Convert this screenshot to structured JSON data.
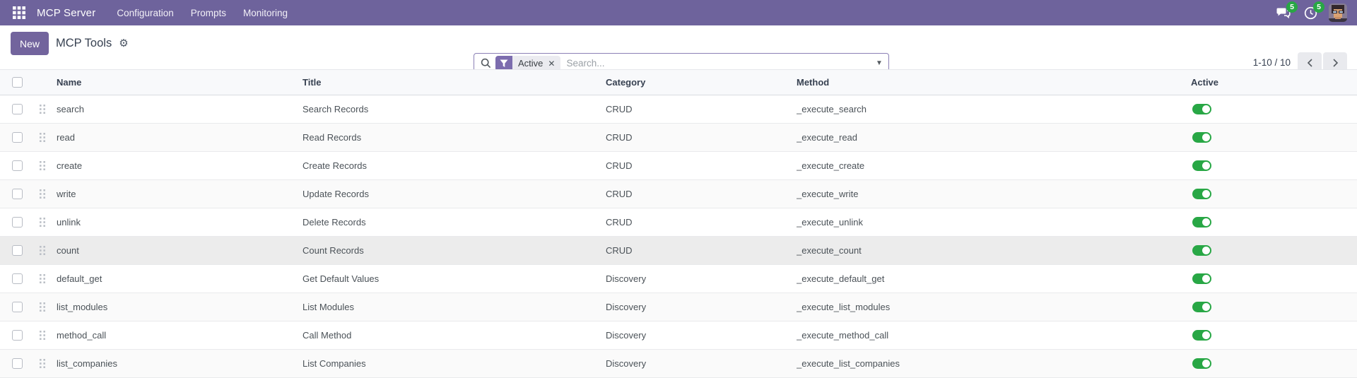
{
  "navbar": {
    "app_name": "MCP Server",
    "menus": [
      {
        "label": "Configuration"
      },
      {
        "label": "Prompts"
      },
      {
        "label": "Monitoring"
      }
    ],
    "messages_badge": "5",
    "activities_badge": "5"
  },
  "control_panel": {
    "new_button_label": "New",
    "breadcrumb_title": "MCP Tools",
    "search": {
      "filter_label": "Active",
      "placeholder": "Search...",
      "value": ""
    },
    "pager": {
      "range": "1-10 / 10",
      "prev": "‹",
      "next": "›"
    }
  },
  "table": {
    "columns": [
      "Name",
      "Title",
      "Category",
      "Method",
      "Active"
    ],
    "rows": [
      {
        "name": "search",
        "title": "Search Records",
        "category": "CRUD",
        "method": "_execute_search",
        "active": true
      },
      {
        "name": "read",
        "title": "Read Records",
        "category": "CRUD",
        "method": "_execute_read",
        "active": true
      },
      {
        "name": "create",
        "title": "Create Records",
        "category": "CRUD",
        "method": "_execute_create",
        "active": true
      },
      {
        "name": "write",
        "title": "Update Records",
        "category": "CRUD",
        "method": "_execute_write",
        "active": true
      },
      {
        "name": "unlink",
        "title": "Delete Records",
        "category": "CRUD",
        "method": "_execute_unlink",
        "active": true
      },
      {
        "name": "count",
        "title": "Count Records",
        "category": "CRUD",
        "method": "_execute_count",
        "active": true,
        "highlighted": true
      },
      {
        "name": "default_get",
        "title": "Get Default Values",
        "category": "Discovery",
        "method": "_execute_default_get",
        "active": true
      },
      {
        "name": "list_modules",
        "title": "List Modules",
        "category": "Discovery",
        "method": "_execute_list_modules",
        "active": true
      },
      {
        "name": "method_call",
        "title": "Call Method",
        "category": "Discovery",
        "method": "_execute_method_call",
        "active": true
      },
      {
        "name": "list_companies",
        "title": "List Companies",
        "category": "Discovery",
        "method": "_execute_list_companies",
        "active": true
      }
    ]
  },
  "colors": {
    "navbar_bg": "#6e639c",
    "accent_purple": "#72649d",
    "facet_purple": "#7c6cae",
    "toggle_green": "#28a745",
    "badge_green": "#28a745",
    "row_highlight": "#ececec"
  }
}
